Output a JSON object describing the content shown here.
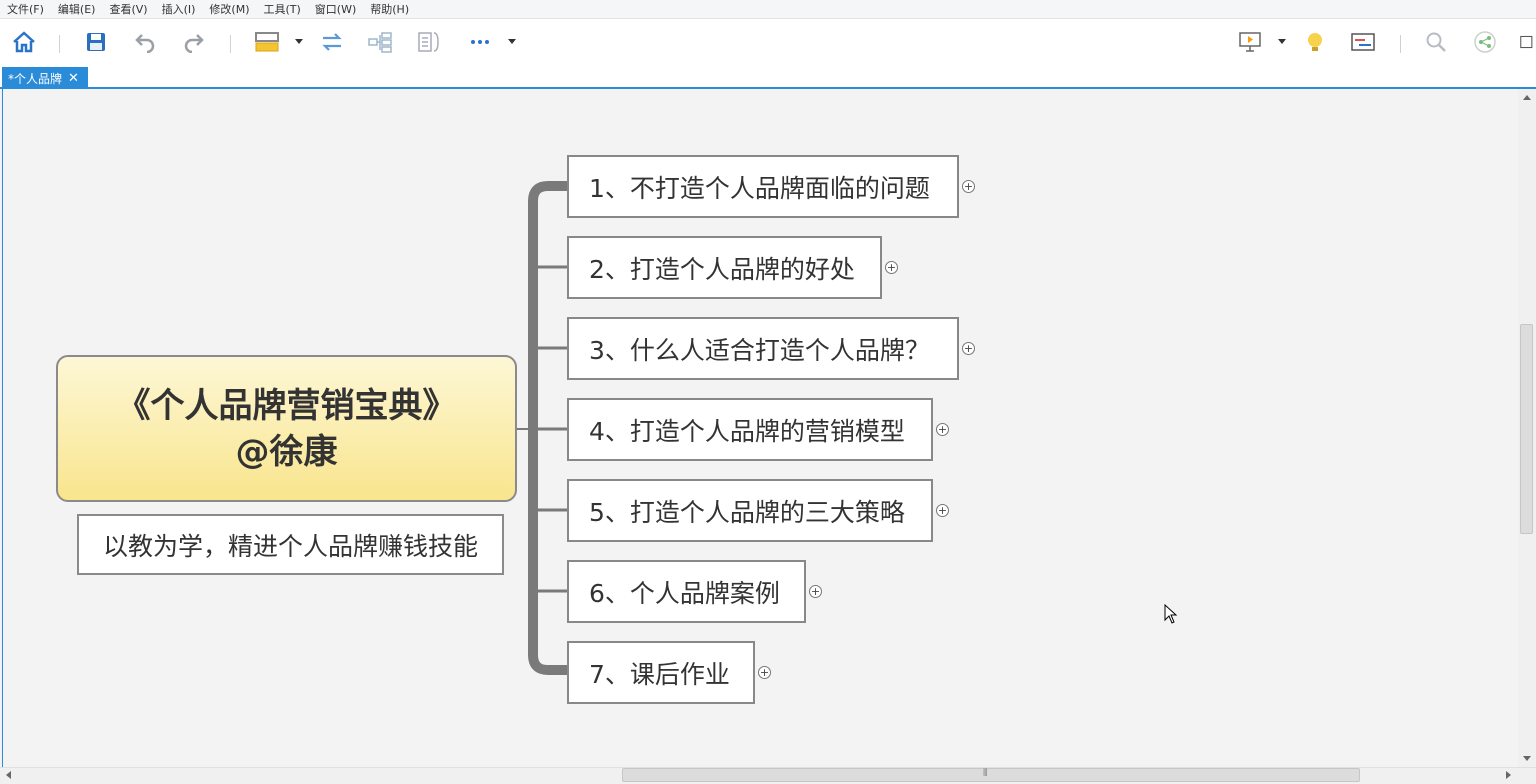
{
  "menu": [
    "文件(F)",
    "编辑(E)",
    "查看(V)",
    "插入(I)",
    "修改(M)",
    "工具(T)",
    "窗口(W)",
    "帮助(H)"
  ],
  "toolbar": {
    "icons": [
      "home-icon",
      "save-icon",
      "undo-icon",
      "redo-icon",
      "topic-icon",
      "relationship-icon",
      "structure-icon",
      "summary-icon",
      "more-icon",
      "presentation-icon",
      "idea-icon",
      "gantt-icon",
      "search-icon",
      "share-icon"
    ]
  },
  "tab": {
    "title": "*个人品牌",
    "close": "✕"
  },
  "mindmap": {
    "central": {
      "title": "《个人品牌营销宝典》",
      "author": "@徐康"
    },
    "subtitle": "以教为学，精进个人品牌赚钱技能",
    "branches": [
      {
        "label": "1、不打造个人品牌面临的问题"
      },
      {
        "label": "2、打造个人品牌的好处"
      },
      {
        "label": "3、什么人适合打造个人品牌？"
      },
      {
        "label": "4、打造个人品牌的营销模型"
      },
      {
        "label": "5、打造个人品牌的三大策略"
      },
      {
        "label": "6、个人品牌案例"
      },
      {
        "label": "7、课后作业"
      }
    ],
    "expand_symbol": "+"
  },
  "scrollbar": {
    "grip": "⦀"
  },
  "colors": {
    "accent": "#2a8bd8",
    "central_fill": "#f9e58d",
    "connector": "#7a7a7a"
  }
}
